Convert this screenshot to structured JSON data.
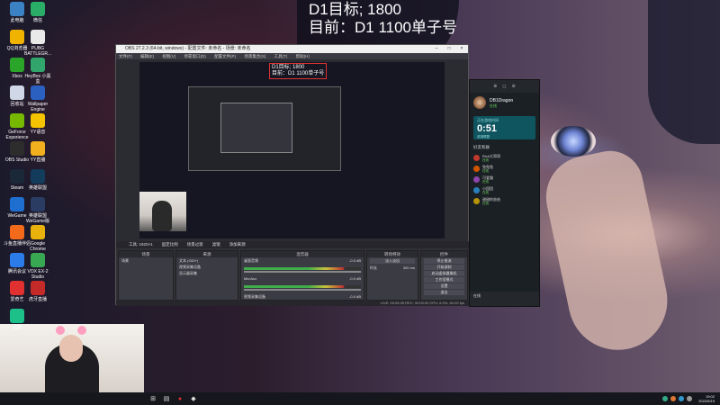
{
  "overlay": {
    "title": "D1目标; 1800",
    "subtitle": "目前：D1 1100单子号"
  },
  "desktop_icons": [
    {
      "label": "此电脑",
      "color": "#3b82c4"
    },
    {
      "label": "微信",
      "color": "#2aae67"
    },
    {
      "label": "QQ浏览器",
      "color": "#f0b400"
    },
    {
      "label": "PUBG BATTLEGR...",
      "color": "#e9e9e9"
    },
    {
      "label": "Xbox",
      "color": "#2aa52a"
    },
    {
      "label": "HeyBox 小黑盒",
      "color": "#31a66c"
    },
    {
      "label": "回收站",
      "color": "#d0d8e8"
    },
    {
      "label": "Wallpaper Engine",
      "color": "#2b5fc0"
    },
    {
      "label": "GeForce Experience",
      "color": "#76b900"
    },
    {
      "label": "YY语音",
      "color": "#f5c400"
    },
    {
      "label": "OBS Studio",
      "color": "#2d2d2d"
    },
    {
      "label": "YY直播",
      "color": "#f2b01e"
    },
    {
      "label": "Steam",
      "color": "#1b2838"
    },
    {
      "label": "英雄联盟",
      "color": "#123b5c"
    },
    {
      "label": "WeGame",
      "color": "#1f6fd1"
    },
    {
      "label": "英雄联盟WeGame版",
      "color": "#2a3c62"
    },
    {
      "label": "斗鱼直播伴侣",
      "color": "#f36a1b"
    },
    {
      "label": "Google Chrome",
      "color": "#e8b10c"
    },
    {
      "label": "腾讯会议",
      "color": "#2b7ce9"
    },
    {
      "label": "VOX EX-2 Studio",
      "color": "#39a852"
    },
    {
      "label": "爱奇艺",
      "color": "#e03030"
    },
    {
      "label": "虎牙直播",
      "color": "#c52a2a"
    },
    {
      "label": "迅雷",
      "color": "#1ec08a"
    }
  ],
  "obs": {
    "window_title": "OBS 27.2.3 (64-bit, windows) - 配置文件: 未命名 - 场景: 未命名",
    "menu": [
      "文件(F)",
      "编辑(E)",
      "视图(V)",
      "停靠窗口(D)",
      "配置文件(P)",
      "场景集合(S)",
      "工具(T)",
      "帮助(H)"
    ],
    "scene_tabs": [
      "工具: 1920×1",
      "固定比例",
      "场景过渡",
      "滤镜",
      "添加来源"
    ],
    "docks": {
      "scenes": {
        "title": "场景",
        "items": [
          "场景"
        ]
      },
      "sources": {
        "title": "来源",
        "items": [
          "文本 (GDI+)",
          "视频采集设备",
          "显示器采集"
        ]
      },
      "mixer": {
        "title": "混音器",
        "channels": [
          "桌面音频",
          "Mic/Aux",
          "视频采集设备"
        ],
        "levels": [
          "-0.0 dB",
          "-0.0 dB",
          "-0.0 dB"
        ]
      },
      "transitions": {
        "title": "转场特效",
        "value": "淡入淡出",
        "duration_label": "时长",
        "duration": "300 ms"
      },
      "controls": {
        "title": "控件",
        "buttons": [
          "停止推流",
          "开始录制",
          "启动虚拟摄像机",
          "工作室模式",
          "设置",
          "退出"
        ]
      }
    },
    "status": "LIVE: 00:09:35   REC: 00:00:00   CPU: 6.3%, 60.00 fps"
  },
  "xbox": {
    "profile_name": "DB1Dragon",
    "profile_status": "在线",
    "timer_label": "正在游戏时间",
    "timer": "0:51",
    "timer_sub": "英雄联盟",
    "friends_header": "好友和群",
    "friends": [
      {
        "name": "Rich大哥哥",
        "status": "在线",
        "color": "#c0392b"
      },
      {
        "name": "兔兔兔",
        "status": "在线",
        "color": "#d35400"
      },
      {
        "name": "可爱猫",
        "status": "在线",
        "color": "#8e44ad"
      },
      {
        "name": "小团团",
        "status": "在线",
        "color": "#2980b9"
      },
      {
        "name": "甜甜的爸爸",
        "status": "在线",
        "color": "#b7950b"
      }
    ],
    "bottom_text": "在线"
  },
  "taskbar": {
    "time": "19:02",
    "date": "2022/6/19"
  }
}
